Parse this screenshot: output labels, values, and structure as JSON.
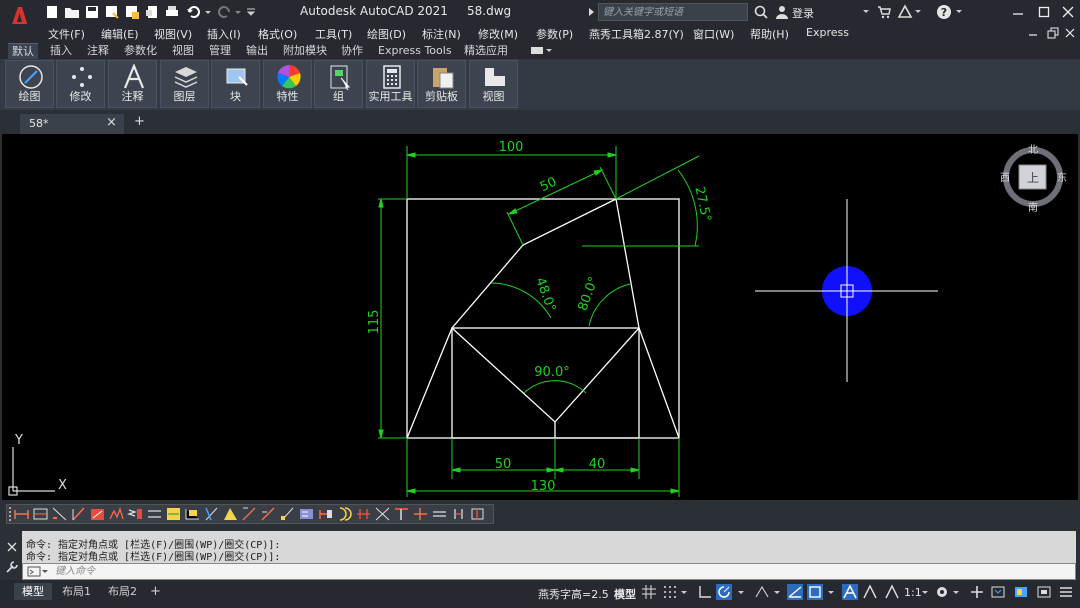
{
  "title_bar": {
    "title": "Autodesk AutoCAD 2021     58.dwg",
    "search_placeholder": "键入关键字或短语",
    "login_label": "登录"
  },
  "menu": [
    "文件(F)",
    "编辑(E)",
    "视图(V)",
    "插入(I)",
    "格式(O)",
    "工具(T)",
    "绘图(D)",
    "标注(N)",
    "修改(M)",
    "参数(P)",
    "燕秀工具箱2.87(Y)",
    "窗口(W)",
    "帮助(H)",
    "Express"
  ],
  "ribbon_tabs": [
    "默认",
    "插入",
    "注释",
    "参数化",
    "视图",
    "管理",
    "输出",
    "附加模块",
    "协作",
    "Express Tools",
    "精选应用"
  ],
  "ribbon_buttons": [
    "绘图",
    "修改",
    "注释",
    "图层",
    "块",
    "特性",
    "组",
    "实用工具",
    "剪贴板",
    "视图"
  ],
  "document_tab": {
    "label": "58*",
    "close": "×",
    "add": "+"
  },
  "drawing": {
    "dims": {
      "top_width": "100",
      "slant_len": "50",
      "angle_top": "27.5°",
      "height": "115",
      "angle_left": "48.0°",
      "angle_right": "80.0°",
      "angle_bottom": "90.0°",
      "bottom_left": "50",
      "bottom_right": "40",
      "overall_width": "130"
    },
    "viewcube": {
      "north": "北",
      "south": "南",
      "east": "东",
      "west": "西",
      "face": "上"
    },
    "ucs": {
      "x": "X",
      "y": "Y"
    },
    "colors": {
      "dimension": "#1fd11f",
      "geometry": "#ffffff",
      "grip": "#1010ff",
      "background": "#000000"
    }
  },
  "command": {
    "line1": "命令: 指定对角点或 [栏选(F)/圈围(WP)/圈交(CP)]:",
    "line2": "命令: 指定对角点或 [栏选(F)/圈围(WP)/圈交(CP)]:",
    "input_placeholder": "键入命令"
  },
  "status": {
    "layout_tabs": [
      "模型",
      "布局1",
      "布局2"
    ],
    "text_height": "燕秀字高=2.5",
    "model_label": "模型",
    "scale": "1:1"
  }
}
